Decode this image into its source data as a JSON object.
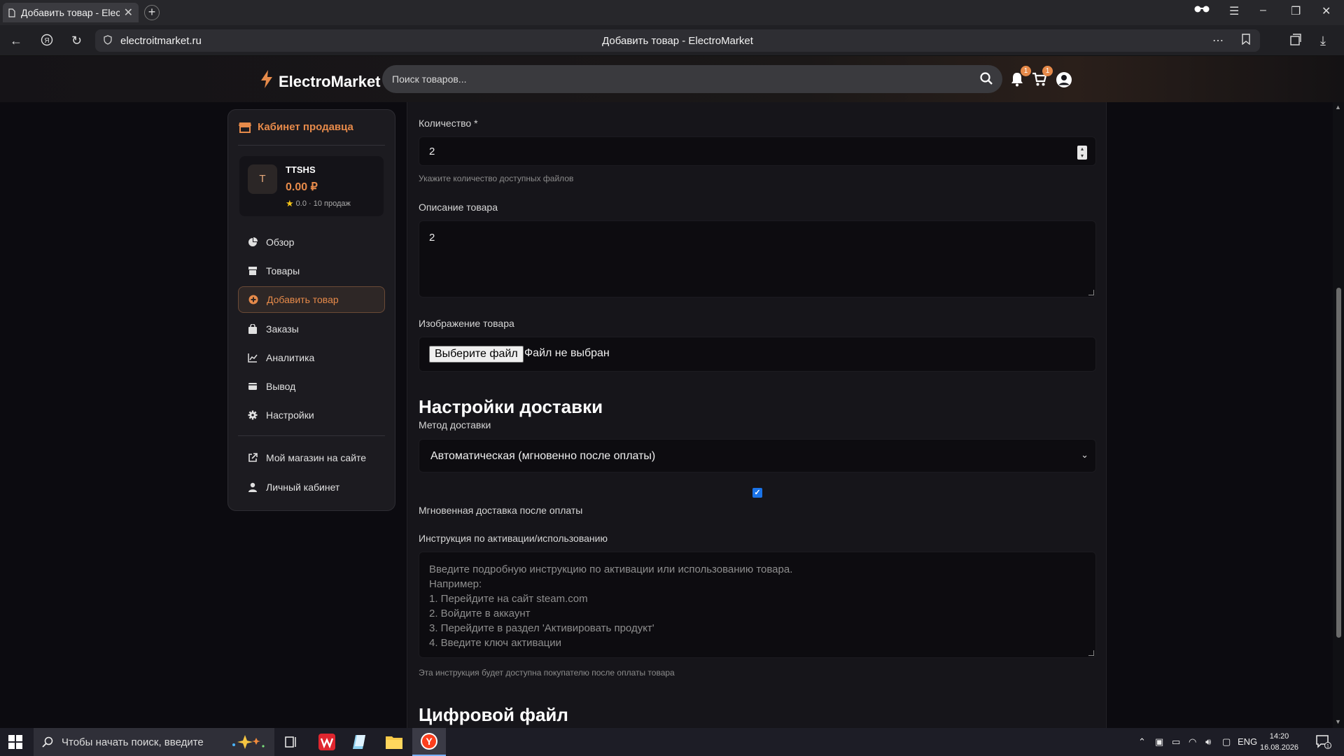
{
  "browser": {
    "tab_title": "Добавить товар - ElectroMarket",
    "url": "electroitmarket.ru",
    "page_title": "Добавить товар - ElectroMarket"
  },
  "header": {
    "logo": "ElectroMarket",
    "search_placeholder": "Поиск товаров...",
    "notifications_count": "1",
    "cart_count": "1",
    "accent": "#e68a4a"
  },
  "sidebar": {
    "title": "Кабинет продавца",
    "profile": {
      "initial": "T",
      "name": "TTSHS",
      "balance": "0.00 ₽",
      "rating": "0.0 · 10 продаж"
    },
    "items": [
      {
        "label": "Обзор",
        "icon": "chart-pie-icon"
      },
      {
        "label": "Товары",
        "icon": "box-icon"
      },
      {
        "label": "Добавить товар",
        "icon": "plus-circle-icon",
        "active": true
      },
      {
        "label": "Заказы",
        "icon": "bag-icon"
      },
      {
        "label": "Аналитика",
        "icon": "line-chart-icon"
      },
      {
        "label": "Вывод",
        "icon": "wallet-icon"
      },
      {
        "label": "Настройки",
        "icon": "gear-icon"
      }
    ],
    "bottom_items": [
      {
        "label": "Мой магазин на сайте",
        "icon": "external-link-icon"
      },
      {
        "label": "Личный кабинет",
        "icon": "user-icon"
      }
    ]
  },
  "form": {
    "quantity_label": "Количество *",
    "quantity_value": "2",
    "quantity_hint": "Укажите количество доступных файлов",
    "description_label": "Описание товара",
    "description_value": "2",
    "image_label": "Изображение товара",
    "file_button": "Выберите файл",
    "file_status": "Файл не выбран",
    "delivery_section": "Настройки доставки",
    "delivery_method_label": "Метод доставки",
    "delivery_method_value": "Автоматическая (мгновенно после оплаты)",
    "instant_checked": true,
    "instant_label": "Мгновенная доставка после оплаты",
    "instruction_label": "Инструкция по активации/использованию",
    "instruction_placeholder": "Введите подробную инструкцию по активации или использованию товара.\nНапример:\n1. Перейдите на сайт steam.com\n2. Войдите в аккаунт\n3. Перейдите в раздел 'Активировать продукт'\n4. Введите ключ активации",
    "instruction_hint": "Эта инструкция будет доступна покупателю после оплаты товара",
    "digital_file_section": "Цифровой файл"
  },
  "taskbar": {
    "search_placeholder": "Чтобы начать поиск, введите",
    "lang": "ENG",
    "time": "14:20",
    "date": "16.08.2026",
    "notification_count": "1"
  }
}
